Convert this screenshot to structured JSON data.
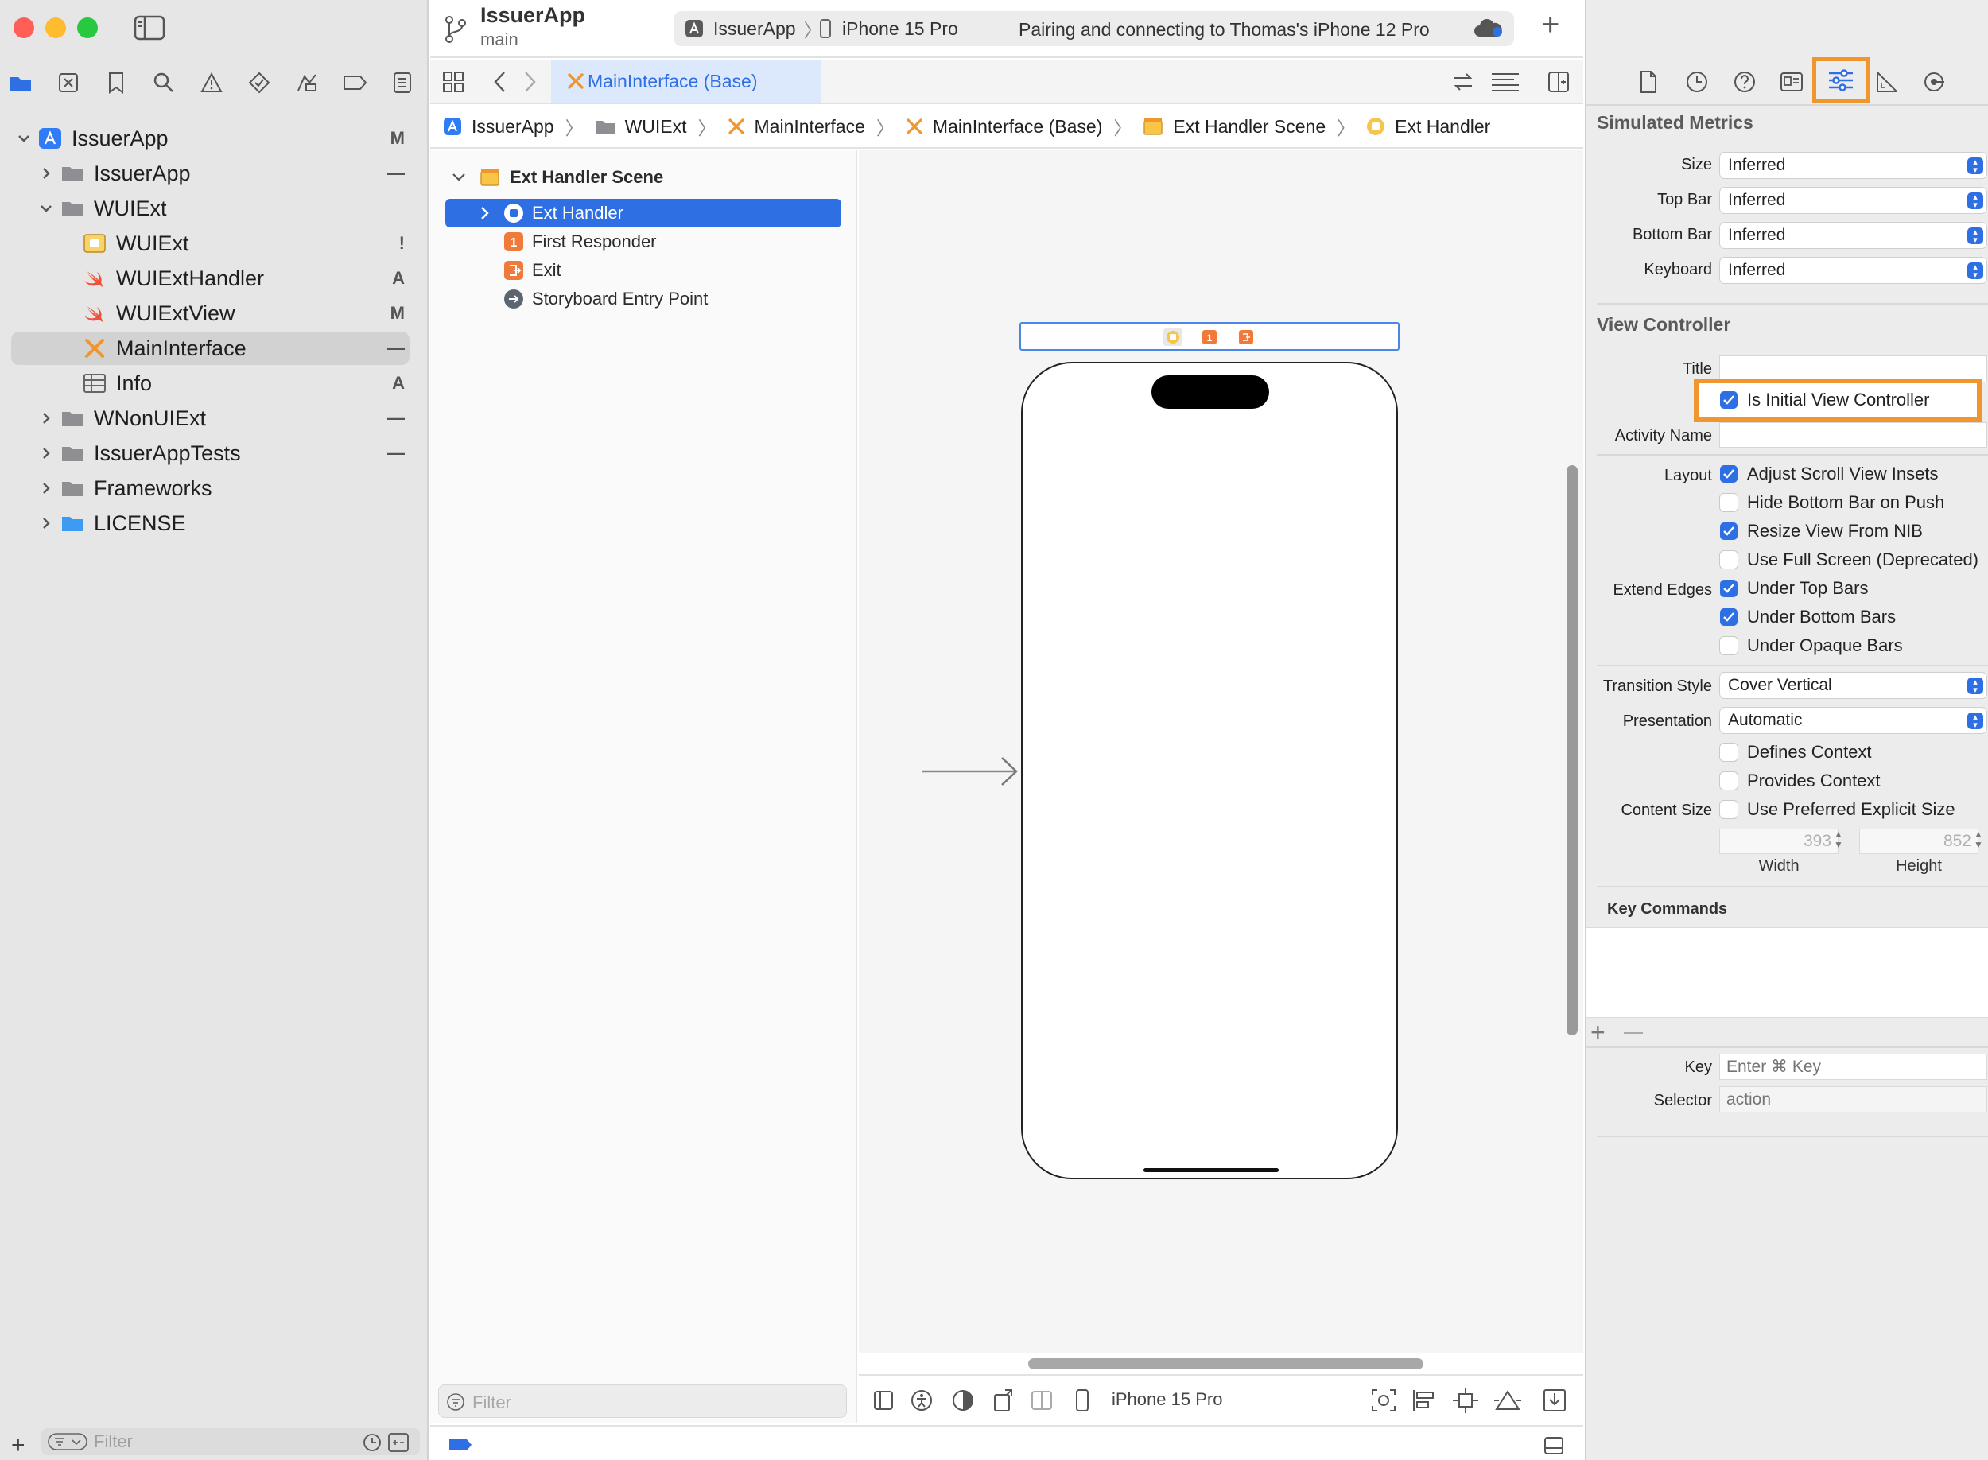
{
  "window": {
    "project_name": "IssuerApp",
    "branch": "main"
  },
  "scheme": {
    "target": "IssuerApp",
    "device": "iPhone 15 Pro",
    "status": "Pairing and connecting to Thomas's iPhone 12 Pro"
  },
  "navigator": {
    "items": [
      {
        "label": "IssuerApp",
        "badge": "M"
      },
      {
        "label": "IssuerApp",
        "badge": "—"
      },
      {
        "label": "WUIExt",
        "badge": ""
      },
      {
        "label": "WUIExt",
        "badge": "!"
      },
      {
        "label": "WUIExtHandler",
        "badge": "A"
      },
      {
        "label": "WUIExtView",
        "badge": "M"
      },
      {
        "label": "MainInterface",
        "badge": "—"
      },
      {
        "label": "Info",
        "badge": "A"
      },
      {
        "label": "WNonUIExt",
        "badge": "—"
      },
      {
        "label": "IssuerAppTests",
        "badge": "—"
      },
      {
        "label": "Frameworks",
        "badge": ""
      },
      {
        "label": "LICENSE",
        "badge": ""
      }
    ],
    "filter_placeholder": "Filter"
  },
  "editor": {
    "tab_label": "MainInterface (Base)",
    "breadcrumb": [
      "IssuerApp",
      "WUIExt",
      "MainInterface",
      "MainInterface (Base)",
      "Ext Handler Scene",
      "Ext Handler"
    ]
  },
  "outline": {
    "scene": "Ext Handler Scene",
    "items": [
      "Ext Handler",
      "First Responder",
      "Exit",
      "Storyboard Entry Point"
    ],
    "filter_placeholder": "Filter"
  },
  "canvas": {
    "device_label": "iPhone 15 Pro"
  },
  "inspector": {
    "simulated_metrics": {
      "title": "Simulated Metrics",
      "rows": [
        {
          "label": "Size",
          "value": "Inferred"
        },
        {
          "label": "Top Bar",
          "value": "Inferred"
        },
        {
          "label": "Bottom Bar",
          "value": "Inferred"
        },
        {
          "label": "Keyboard",
          "value": "Inferred"
        }
      ]
    },
    "view_controller": {
      "title": "View Controller",
      "title_label": "Title",
      "title_value": "",
      "initial_vc_label": "Is Initial View Controller",
      "initial_vc_checked": true,
      "activity_name_label": "Activity Name",
      "layout_label": "Layout",
      "layout_options": [
        {
          "label": "Adjust Scroll View Insets",
          "checked": true
        },
        {
          "label": "Hide Bottom Bar on Push",
          "checked": false
        },
        {
          "label": "Resize View From NIB",
          "checked": true
        },
        {
          "label": "Use Full Screen (Deprecated)",
          "checked": false
        }
      ],
      "extend_edges_label": "Extend Edges",
      "extend_edges_options": [
        {
          "label": "Under Top Bars",
          "checked": true
        },
        {
          "label": "Under Bottom Bars",
          "checked": true
        },
        {
          "label": "Under Opaque Bars",
          "checked": false
        }
      ],
      "transition_style_label": "Transition Style",
      "transition_style_value": "Cover Vertical",
      "presentation_label": "Presentation",
      "presentation_value": "Automatic",
      "context_options": [
        {
          "label": "Defines Context",
          "checked": false
        },
        {
          "label": "Provides Context",
          "checked": false
        }
      ],
      "content_size_label": "Content Size",
      "content_size_option": {
        "label": "Use Preferred Explicit Size",
        "checked": false
      },
      "width_value": "393",
      "height_value": "852",
      "width_label": "Width",
      "height_label": "Height"
    },
    "key_commands": {
      "title": "Key Commands",
      "key_label": "Key",
      "key_placeholder": "Enter ⌘ Key",
      "selector_label": "Selector",
      "selector_placeholder": "action"
    }
  },
  "colors": {
    "accent": "#2f6fe4",
    "highlight": "#f0962e",
    "swift": "#f05138"
  }
}
